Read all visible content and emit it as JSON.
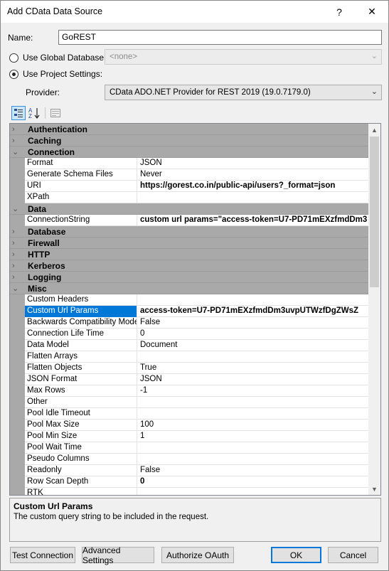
{
  "window": {
    "title": "Add CData Data Source",
    "help_glyph": "?",
    "close_glyph": "✕"
  },
  "form": {
    "name_label": "Name:",
    "name_value": "GoREST",
    "global_db_label": "Use Global Database:",
    "global_db_value": "<none>",
    "project_settings_label": "Use Project Settings:",
    "provider_label": "Provider:",
    "provider_value": "CData ADO.NET Provider for REST 2019 (19.0.7179.0)",
    "selected_option": "project_settings"
  },
  "toolbar": {
    "categorized_icon": "categorized-icon",
    "alphabetical_icon": "sort-az-icon",
    "property_pages_icon": "property-pages-icon"
  },
  "grid": {
    "categories": [
      {
        "name": "Authentication",
        "expanded": false,
        "properties": []
      },
      {
        "name": "Caching",
        "expanded": false,
        "properties": []
      },
      {
        "name": "Connection",
        "expanded": true,
        "properties": [
          {
            "name": "Format",
            "value": "JSON",
            "bold": false
          },
          {
            "name": "Generate Schema Files",
            "value": "Never",
            "bold": false
          },
          {
            "name": "URI",
            "value": "https://gorest.co.in/public-api/users?_format=json",
            "bold": true
          },
          {
            "name": "XPath",
            "value": "",
            "bold": false
          }
        ]
      },
      {
        "name": "Data",
        "expanded": true,
        "properties": [
          {
            "name": "ConnectionString",
            "value": "custom url params=\"access-token=U7-PD71mEXzfmdDm3",
            "bold": true
          }
        ]
      },
      {
        "name": "Database",
        "expanded": false,
        "properties": []
      },
      {
        "name": "Firewall",
        "expanded": false,
        "properties": []
      },
      {
        "name": "HTTP",
        "expanded": false,
        "properties": []
      },
      {
        "name": "Kerberos",
        "expanded": false,
        "properties": []
      },
      {
        "name": "Logging",
        "expanded": false,
        "properties": []
      },
      {
        "name": "Misc",
        "expanded": true,
        "properties": [
          {
            "name": "Custom Headers",
            "value": "",
            "bold": false
          },
          {
            "name": "Custom Url Params",
            "value": "access-token=U7-PD71mEXzfmdDm3uvpUTWzfDgZWsZ",
            "bold": true,
            "selected": true
          },
          {
            "name": "Backwards Compatibility Mode",
            "value": "False",
            "bold": false
          },
          {
            "name": "Connection Life Time",
            "value": "0",
            "bold": false
          },
          {
            "name": "Data Model",
            "value": "Document",
            "bold": false
          },
          {
            "name": "Flatten Arrays",
            "value": "",
            "bold": false
          },
          {
            "name": "Flatten Objects",
            "value": "True",
            "bold": false
          },
          {
            "name": "JSON Format",
            "value": "JSON",
            "bold": false
          },
          {
            "name": "Max Rows",
            "value": "-1",
            "bold": false
          },
          {
            "name": "Other",
            "value": "",
            "bold": false
          },
          {
            "name": "Pool Idle Timeout",
            "value": "",
            "bold": false
          },
          {
            "name": "Pool Max Size",
            "value": "100",
            "bold": false
          },
          {
            "name": "Pool Min Size",
            "value": "1",
            "bold": false
          },
          {
            "name": "Pool Wait Time",
            "value": "",
            "bold": false
          },
          {
            "name": "Pseudo Columns",
            "value": "",
            "bold": false
          },
          {
            "name": "Readonly",
            "value": "False",
            "bold": false
          },
          {
            "name": "Row Scan Depth",
            "value": "0",
            "bold": true
          },
          {
            "name": "RTK",
            "value": "",
            "bold": false
          }
        ]
      }
    ],
    "scroll_up": "▲",
    "scroll_down": "▼"
  },
  "help": {
    "title": "Custom Url Params",
    "description": "The custom query string to be included in the request."
  },
  "buttons": {
    "test_connection": "Test Connection",
    "advanced_settings": "Advanced Settings",
    "authorize_oauth": "Authorize OAuth",
    "ok": "OK",
    "cancel": "Cancel"
  },
  "colors": {
    "category_band": "#a9a9a9",
    "selection": "#0078d7",
    "dialog_bg": "#f0f0f0"
  }
}
